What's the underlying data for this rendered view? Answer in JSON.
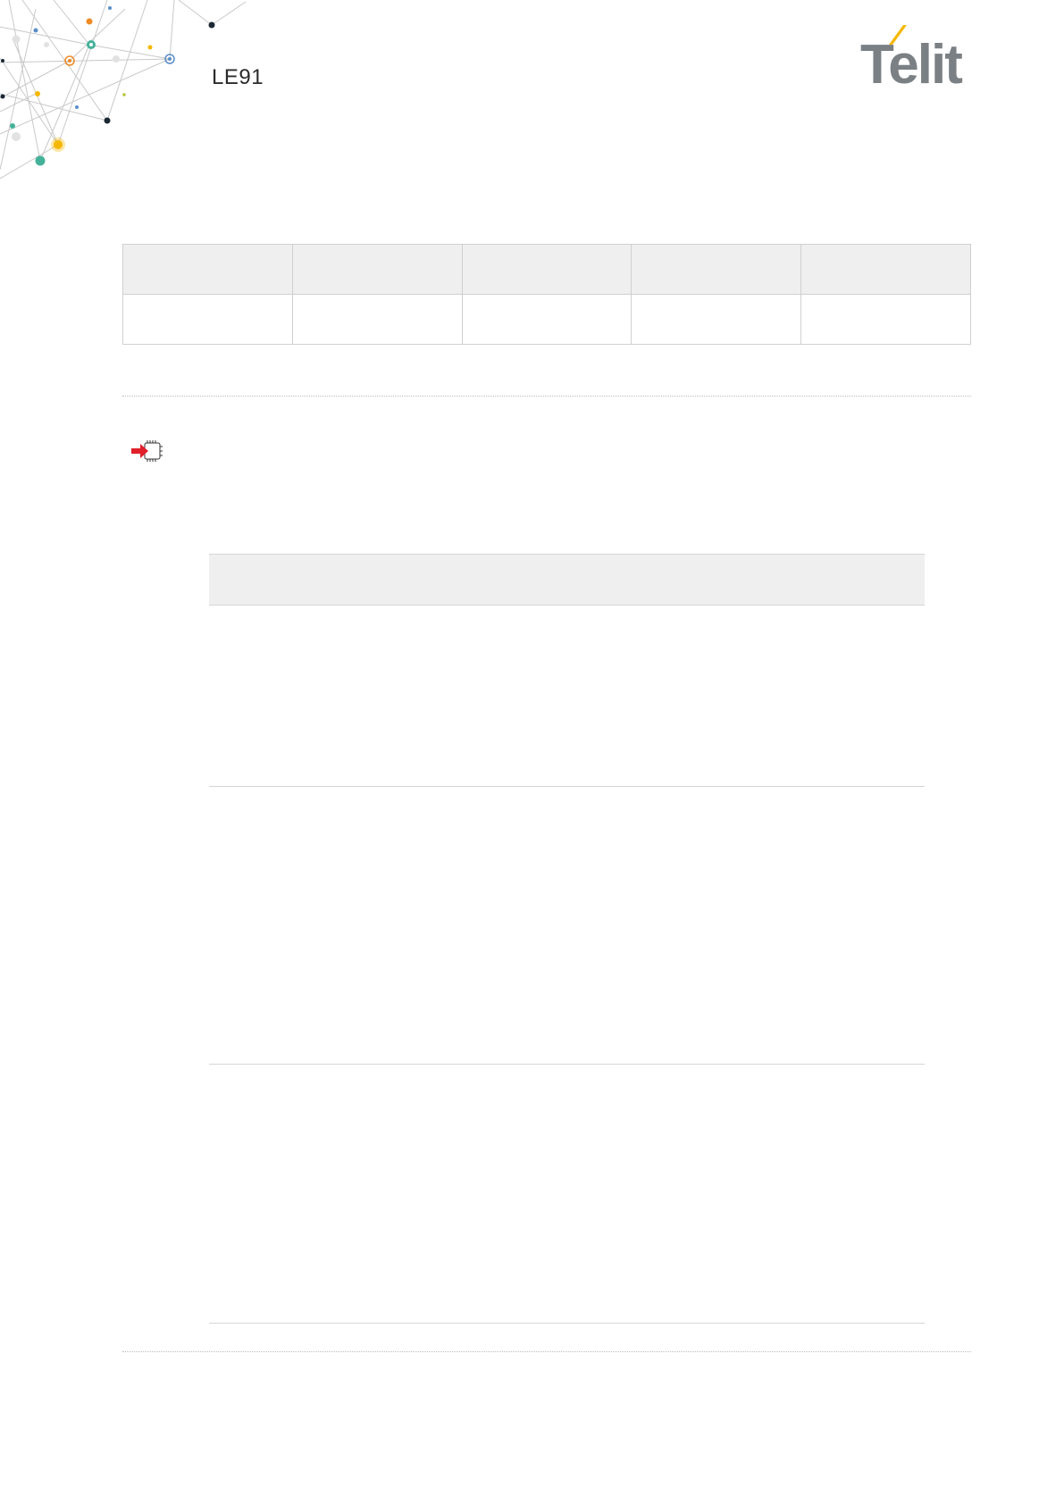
{
  "header": {
    "product_name": "LE91",
    "logo_text": "Telit",
    "decoration": "network-graph-art"
  },
  "colors": {
    "logo_gray": "#7a8084",
    "accent_yellow": "#f5b800",
    "accent_teal": "#44b29a",
    "accent_orange": "#f08a24",
    "accent_blue": "#5b8ec9",
    "note_arrow_red": "#e0202a",
    "table_header_fill": "#efefef"
  },
  "icons": {
    "note": "chip-arrow-icon"
  },
  "top_table": {
    "columns": 5,
    "rows": 2
  },
  "parameter_table": {
    "rows": 3
  }
}
